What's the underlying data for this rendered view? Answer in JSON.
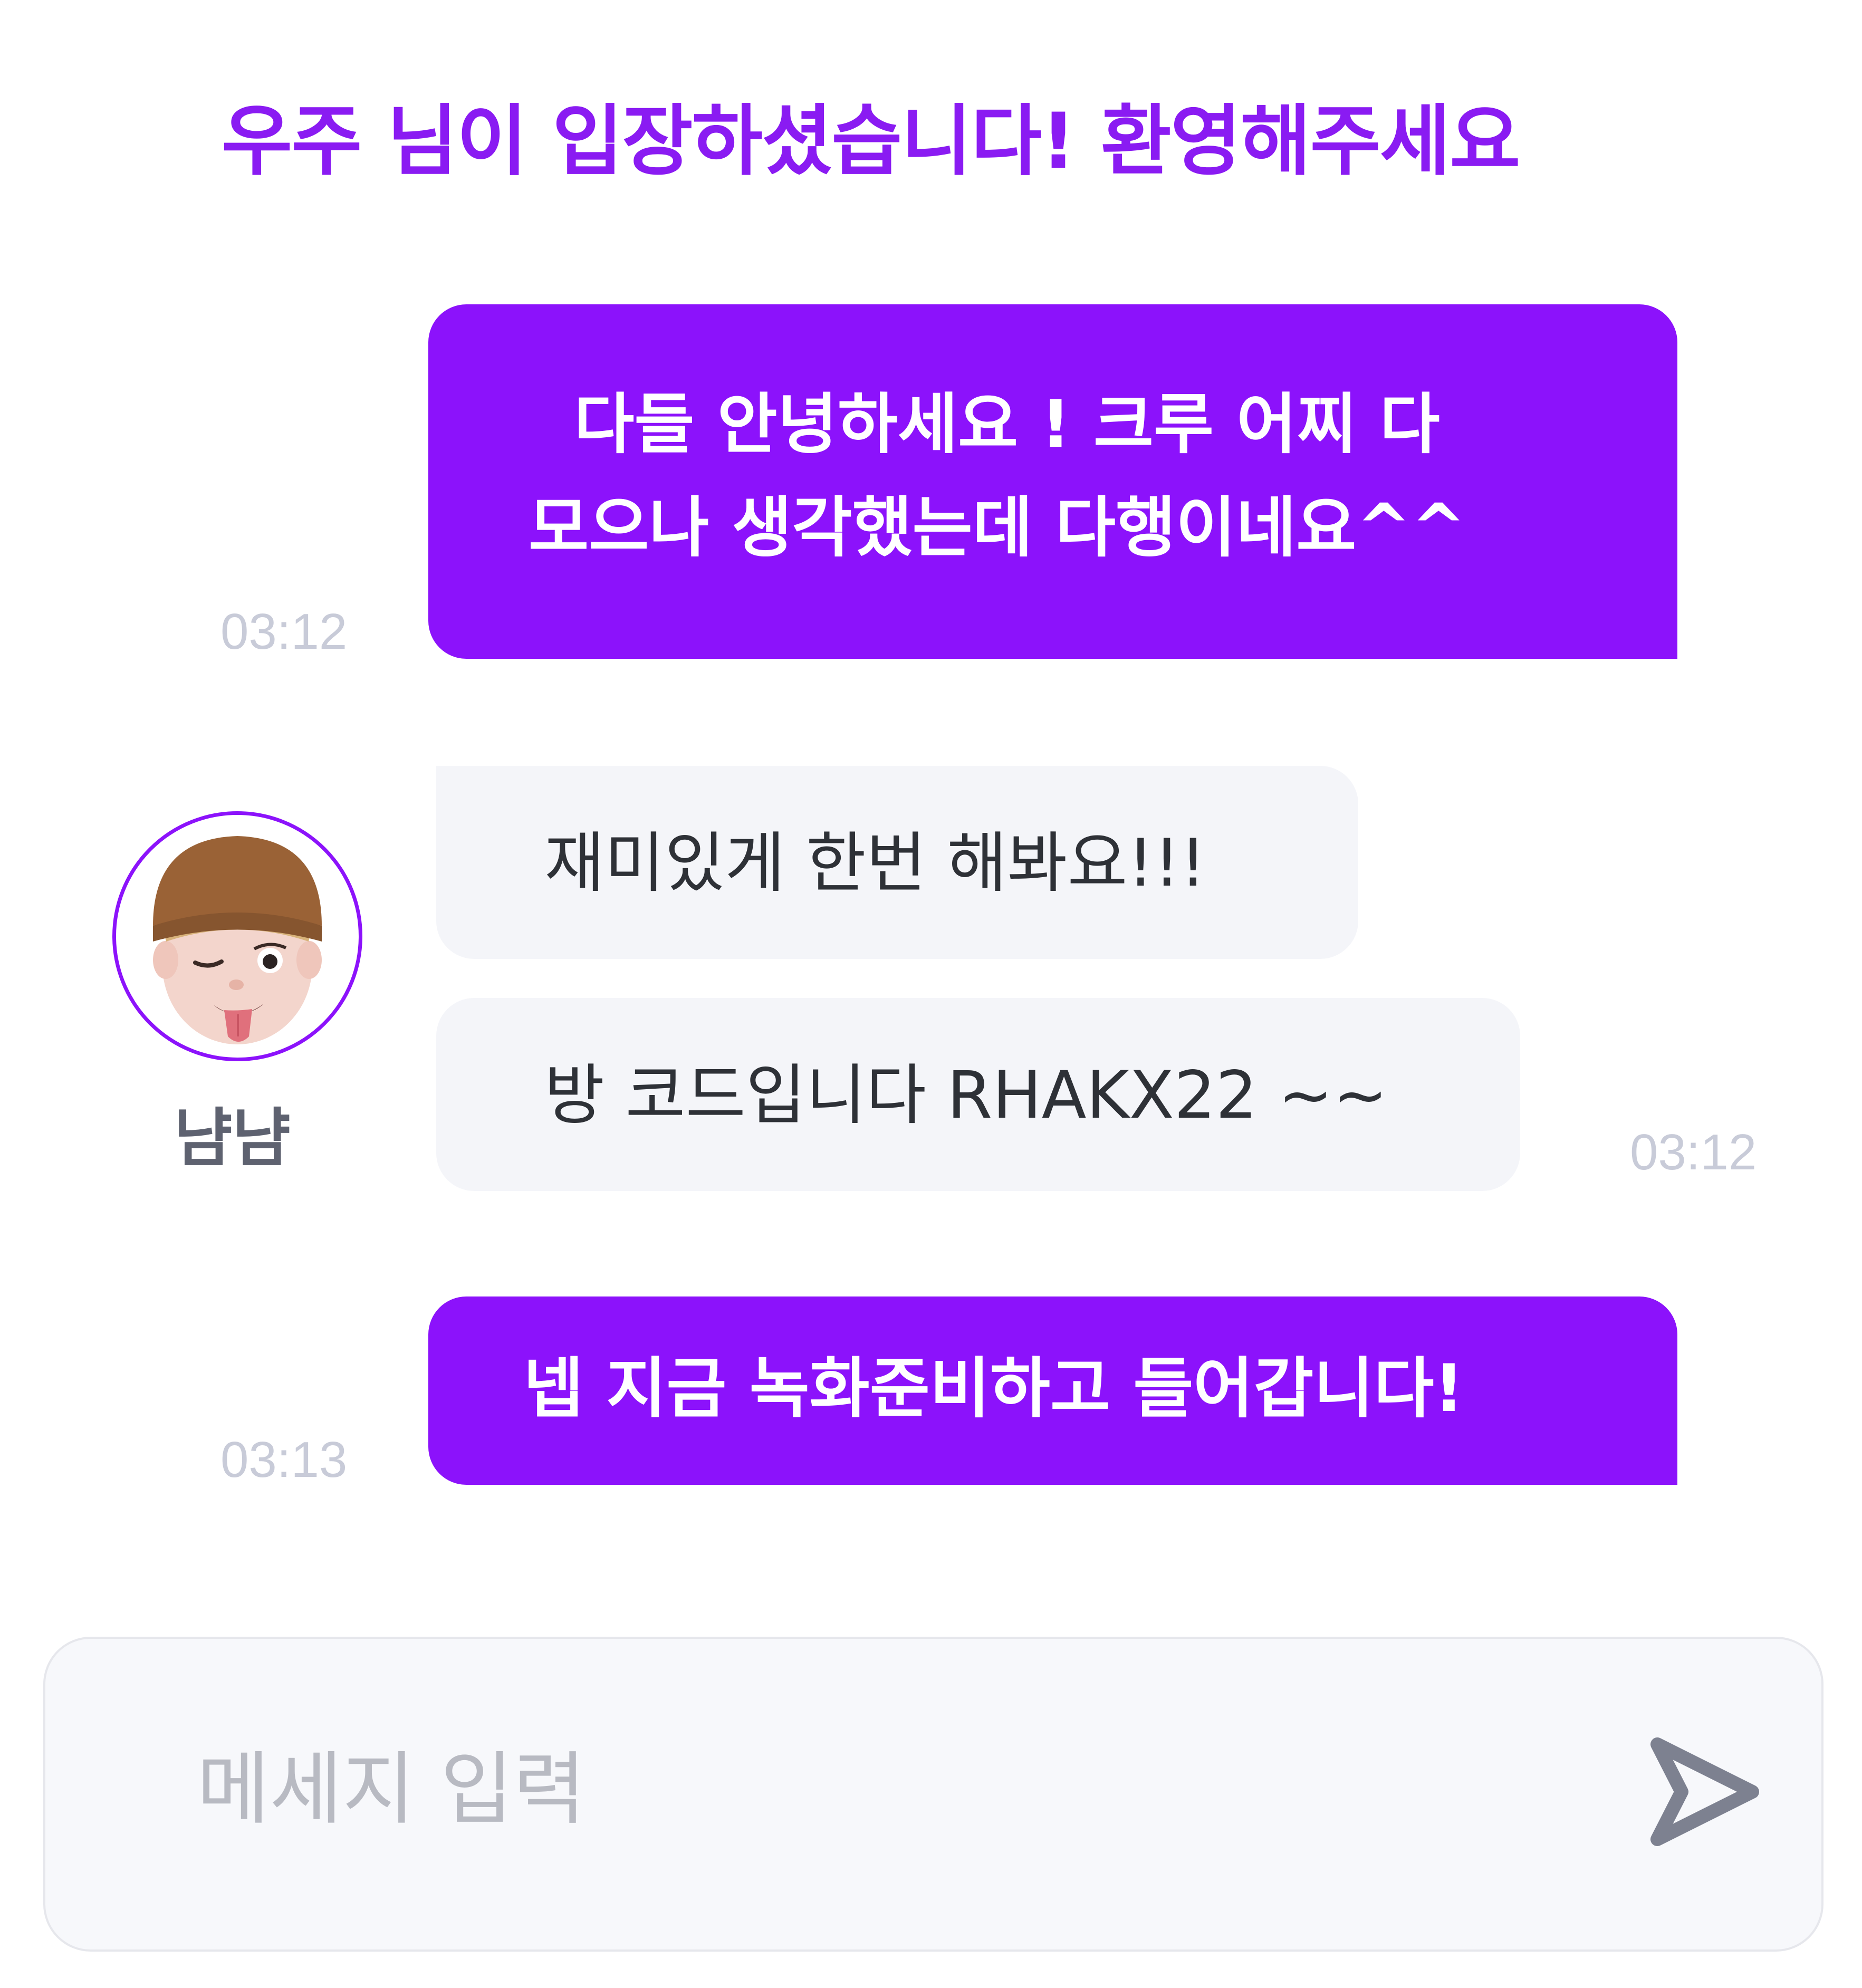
{
  "system_notice": "우주 님이 입장하셨습니다! 환영해주세요",
  "messages": [
    {
      "sender": "me",
      "text": "  다들 안녕하세요 ! 크루 어찌 다\n모으나 생각했는데 다행이네요^^",
      "time": "03:12"
    },
    {
      "sender": "other",
      "text": "재미있게 한번 해봐요!!!"
    },
    {
      "sender": "other",
      "text": "방 코드입니다 RHAKX22 ~~",
      "time": "03:12"
    },
    {
      "sender": "me",
      "text": "넵 지금 녹화준비하고 들어갑니다!",
      "time": "03:13"
    }
  ],
  "other_user": {
    "nickname": "냠냠",
    "avatar_icon": "memoji-avatar-icon"
  },
  "composer": {
    "placeholder": "메세지 입력",
    "value": "",
    "send_icon": "send-arrow-icon"
  },
  "colors": {
    "accent": "#8c12fb",
    "notice": "#8a1bf2",
    "other_bubble": "#f4f5f9",
    "timestamp": "#c8cbd8",
    "icon_gray": "#7d8190"
  }
}
